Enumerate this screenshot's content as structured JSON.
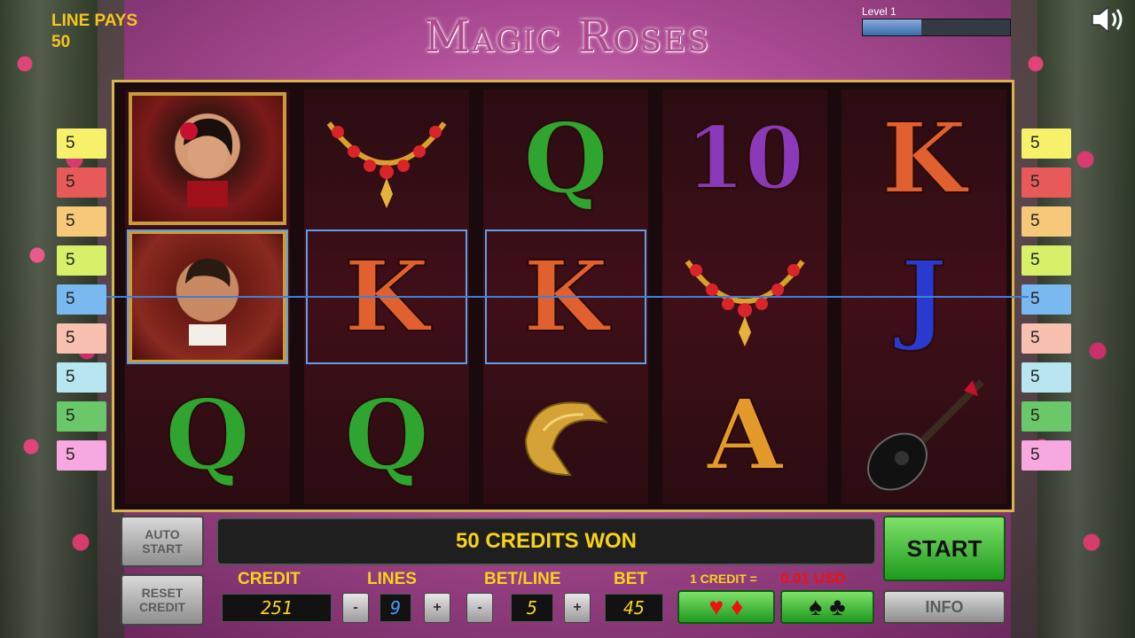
{
  "header": {
    "line_pays_label": "LINE PAYS",
    "line_pays_value": "50",
    "title": "Magic Roses",
    "level_label": "Level 1",
    "level_progress": 0.4
  },
  "line_badges_left": [
    "5",
    "5",
    "5",
    "5",
    "5",
    "5",
    "5",
    "5",
    "5"
  ],
  "line_badges_right": [
    "5",
    "5",
    "5",
    "5",
    "5",
    "5",
    "5",
    "5",
    "5"
  ],
  "badge_colors": [
    "#f7f06a",
    "#e85a5a",
    "#f7c87a",
    "#d7f06a",
    "#7ab8f0",
    "#f7c0b0",
    "#b8e6f0",
    "#6ac86a",
    "#f7a8e0"
  ],
  "reels": [
    [
      "woman-with-rose",
      "man-portrait",
      "Q"
    ],
    [
      "necklace",
      "K",
      "Q"
    ],
    [
      "Q",
      "K",
      "bracelet"
    ],
    [
      "10",
      "necklace",
      "A"
    ],
    [
      "K",
      "J",
      "guitar"
    ]
  ],
  "message": "50 CREDITS WON",
  "buttons": {
    "auto_start": "AUTO START",
    "reset_credit": "RESET CREDIT",
    "start": "START",
    "info": "INFO",
    "minus": "-",
    "plus": "+"
  },
  "labels": {
    "credit": "CREDIT",
    "lines": "LINES",
    "bet_line": "BET/LINE",
    "bet": "BET",
    "credit_rate": "1 CREDIT =",
    "credit_value": "0.01 USD"
  },
  "values": {
    "credit": "251",
    "lines": "9",
    "bet_line": "5",
    "bet": "45"
  },
  "colors": {
    "accent_yellow": "#f7d21a",
    "payline_blue": "#3f7fd6",
    "start_green": "#1e9b1e",
    "credit_value_red": "#e11"
  }
}
